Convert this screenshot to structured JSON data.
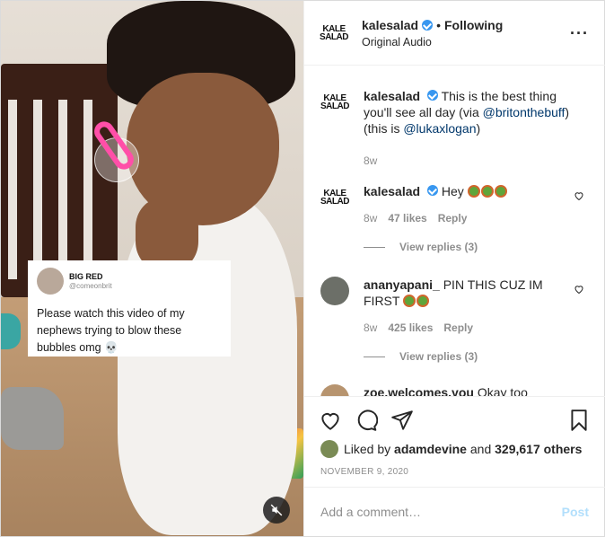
{
  "media": {
    "tweet": {
      "name": "BIG RED",
      "handle": "@comeonbrit",
      "text": "Please watch this video of my nephews trying to blow these bubbles omg 💀"
    },
    "mute_icon": "speaker-muted-icon"
  },
  "header": {
    "logo_text": "KALE\nSALAD",
    "username": "kalesalad",
    "dot": "•",
    "follow_status": "Following",
    "subtitle": "Original Audio",
    "more_icon": "more-options-icon"
  },
  "caption": {
    "username": "kalesalad",
    "text_before": "This is the best thing you'll see all day (via ",
    "mention1": "@britonthebuff",
    "text_mid": ") (this is ",
    "mention2": "@lukaxlogan",
    "text_after": ")",
    "time": "8w"
  },
  "comments": [
    {
      "username": "kalesalad",
      "text": "Hey",
      "emoji_count": 3,
      "time": "8w",
      "likes": "47 likes",
      "reply": "Reply",
      "view_replies": "View replies (3)"
    },
    {
      "username": "ananyapani_",
      "text": "PIN THIS CUZ IM FIRST",
      "emoji_count": 2,
      "time": "8w",
      "likes": "425 likes",
      "reply": "Reply",
      "view_replies": "View replies (3)"
    },
    {
      "username": "zoe.welcomes.you",
      "text": "Okay too"
    }
  ],
  "actions": {
    "liked_by_prefix": "Liked by",
    "liked_by_user": "adamdevine",
    "liked_by_mid": "and",
    "liked_by_count": "329,617 others",
    "date": "NOVEMBER 9, 2020"
  },
  "add_comment": {
    "placeholder": "Add a comment…",
    "post_label": "Post"
  },
  "colors": {
    "link": "#00376b",
    "verified": "#3897f0",
    "post_disabled": "#b2dffc",
    "meta": "#8e8e8e"
  }
}
